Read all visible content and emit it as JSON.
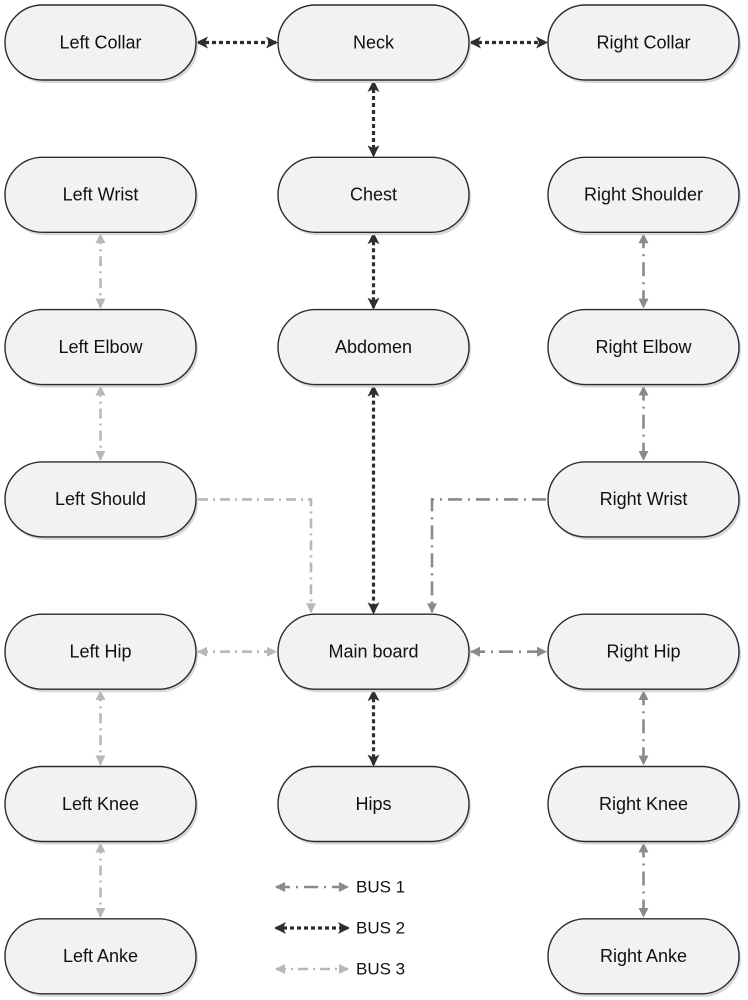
{
  "diagram": {
    "title": "",
    "buses": {
      "bus1": {
        "label": "BUS 1",
        "color": "#8a8a8a",
        "style": "dash-dot"
      },
      "bus2": {
        "label": "BUS 2",
        "color": "#2e2e2e",
        "style": "dotted"
      },
      "bus3": {
        "label": "BUS 3",
        "color": "#b8b8b8",
        "style": "dash-dot-light"
      }
    },
    "nodes": [
      {
        "id": "left-collar",
        "label": "Left Collar",
        "col": 0,
        "row": 0
      },
      {
        "id": "neck",
        "label": "Neck",
        "col": 1,
        "row": 0
      },
      {
        "id": "right-collar",
        "label": "Right Collar",
        "col": 2,
        "row": 0
      },
      {
        "id": "left-wrist",
        "label": "Left Wrist",
        "col": 0,
        "row": 1
      },
      {
        "id": "chest",
        "label": "Chest",
        "col": 1,
        "row": 1
      },
      {
        "id": "right-shoulder",
        "label": "Right Shoulder",
        "col": 2,
        "row": 1
      },
      {
        "id": "left-elbow",
        "label": "Left Elbow",
        "col": 0,
        "row": 2
      },
      {
        "id": "abdomen",
        "label": "Abdomen",
        "col": 1,
        "row": 2
      },
      {
        "id": "right-elbow",
        "label": "Right Elbow",
        "col": 2,
        "row": 2
      },
      {
        "id": "left-should",
        "label": "Left Should",
        "col": 0,
        "row": 3
      },
      {
        "id": "right-wrist",
        "label": "Right Wrist",
        "col": 2,
        "row": 3
      },
      {
        "id": "left-hip",
        "label": "Left Hip",
        "col": 0,
        "row": 4
      },
      {
        "id": "main-board",
        "label": "Main board",
        "col": 1,
        "row": 4
      },
      {
        "id": "right-hip",
        "label": "Right Hip",
        "col": 2,
        "row": 4
      },
      {
        "id": "left-knee",
        "label": "Left Knee",
        "col": 0,
        "row": 5
      },
      {
        "id": "hips",
        "label": "Hips",
        "col": 1,
        "row": 5
      },
      {
        "id": "right-knee",
        "label": "Right Knee",
        "col": 2,
        "row": 5
      },
      {
        "id": "left-anke",
        "label": "Left Anke",
        "col": 0,
        "row": 6
      },
      {
        "id": "right-anke",
        "label": "Right Anke",
        "col": 2,
        "row": 6
      }
    ],
    "edges": [
      {
        "from": "left-collar",
        "to": "neck",
        "bus": "bus2"
      },
      {
        "from": "neck",
        "to": "right-collar",
        "bus": "bus2"
      },
      {
        "from": "neck",
        "to": "chest",
        "bus": "bus2"
      },
      {
        "from": "chest",
        "to": "abdomen",
        "bus": "bus2"
      },
      {
        "from": "abdomen",
        "to": "main-board",
        "bus": "bus2"
      },
      {
        "from": "main-board",
        "to": "hips",
        "bus": "bus2"
      },
      {
        "from": "left-wrist",
        "to": "left-elbow",
        "bus": "bus3"
      },
      {
        "from": "left-elbow",
        "to": "left-should",
        "bus": "bus3"
      },
      {
        "from": "left-should",
        "to": "main-board",
        "bus": "bus3",
        "routed": "elbow-left"
      },
      {
        "from": "left-hip",
        "to": "main-board",
        "bus": "bus3"
      },
      {
        "from": "left-hip",
        "to": "left-knee",
        "bus": "bus3"
      },
      {
        "from": "left-knee",
        "to": "left-anke",
        "bus": "bus3"
      },
      {
        "from": "right-shoulder",
        "to": "right-elbow",
        "bus": "bus1"
      },
      {
        "from": "right-elbow",
        "to": "right-wrist",
        "bus": "bus1"
      },
      {
        "from": "right-wrist",
        "to": "main-board",
        "bus": "bus1",
        "routed": "elbow-right"
      },
      {
        "from": "main-board",
        "to": "right-hip",
        "bus": "bus1"
      },
      {
        "from": "right-hip",
        "to": "right-knee",
        "bus": "bus1"
      },
      {
        "from": "right-knee",
        "to": "right-anke",
        "bus": "bus1"
      }
    ],
    "legend": [
      {
        "bus": "bus1",
        "label": "BUS 1"
      },
      {
        "bus": "bus2",
        "label": "BUS 2"
      },
      {
        "bus": "bus3",
        "label": "BUS 3"
      }
    ]
  }
}
